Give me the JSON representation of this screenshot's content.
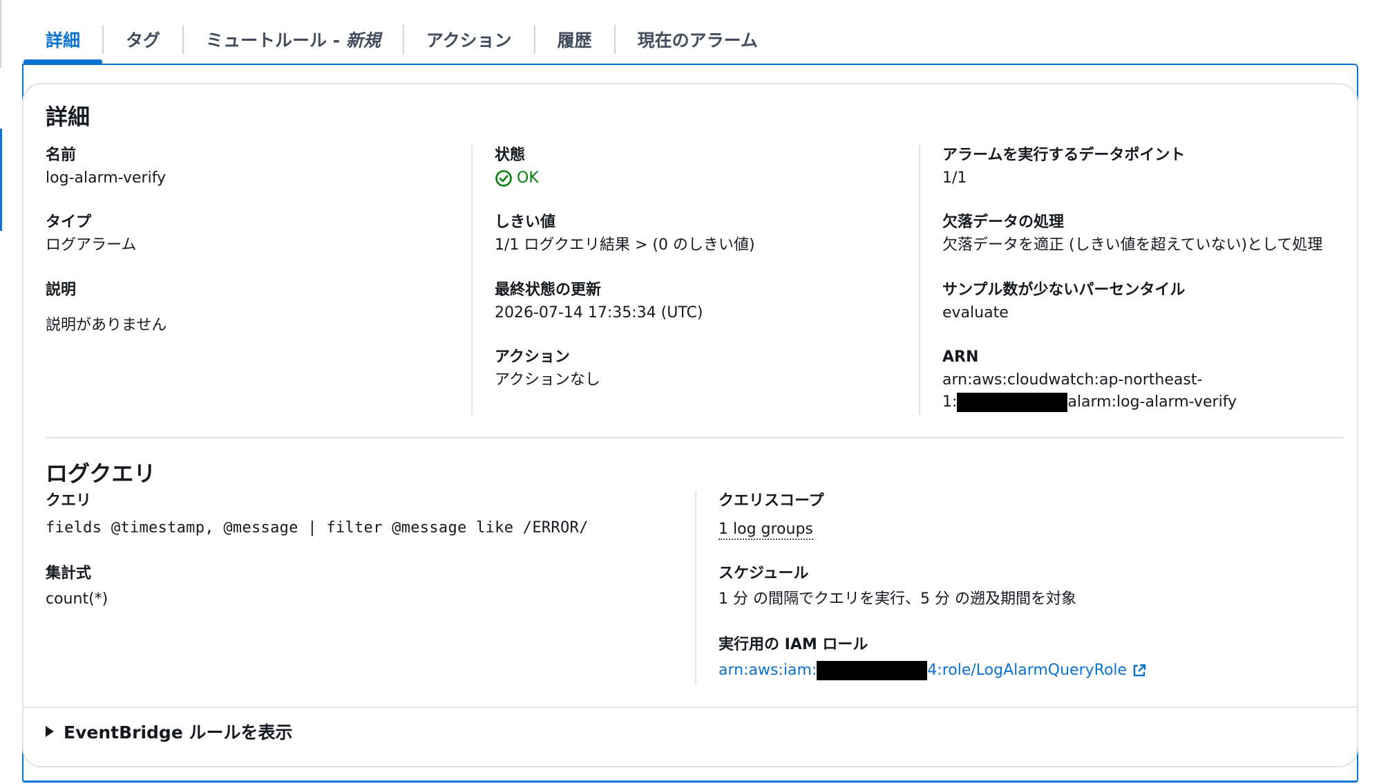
{
  "tabs": [
    {
      "label": "詳細",
      "active": true
    },
    {
      "label": "タグ",
      "active": false
    },
    {
      "label": "ミュートルール - ",
      "italic": "新規",
      "active": false
    },
    {
      "label": "アクション",
      "active": false
    },
    {
      "label": "履歴",
      "active": false
    },
    {
      "label": "現在のアラーム",
      "active": false
    }
  ],
  "details": {
    "title": "詳細",
    "name_label": "名前",
    "name_value": "log-alarm-verify",
    "type_label": "タイプ",
    "type_value": "ログアラーム",
    "desc_label": "説明",
    "desc_value": "説明がありません",
    "state_label": "状態",
    "state_value": "OK",
    "threshold_label": "しきい値",
    "threshold_value": "1/1 ログクエリ結果 > (0 のしきい値)",
    "last_update_label": "最終状態の更新",
    "last_update_value": "2026-07-14 17:35:34 (UTC)",
    "actions_label": "アクション",
    "actions_value": "アクションなし",
    "datapoints_label": "アラームを実行するデータポイント",
    "datapoints_value": "1/1",
    "missing_label": "欠落データの処理",
    "missing_value": "欠落データを適正 (しきい値を超えていない)として処理",
    "percentile_label": "サンプル数が少ないパーセンタイル",
    "percentile_value": "evaluate",
    "arn_label": "ARN",
    "arn_line1": "arn:aws:cloudwatch:ap-northeast-",
    "arn_line2_prefix": "1:",
    "arn_line2_suffix": "alarm:log-alarm-verify"
  },
  "log_query": {
    "title": "ログクエリ",
    "query_label": "クエリ",
    "query_value": "fields @timestamp, @message | filter @message like /ERROR/",
    "agg_label": "集計式",
    "agg_value": "count(*)",
    "scope_label": "クエリスコープ",
    "scope_value": "1 log groups",
    "schedule_label": "スケジュール",
    "schedule_value": "1 分 の間隔でクエリを実行、5 分 の遡及期間を対象",
    "iam_label": "実行用の IAM ロール",
    "iam_prefix": "arn:aws:iam:",
    "iam_suffix": "4:role/LogAlarmQueryRole"
  },
  "eventbridge": {
    "label": "EventBridge ルールを表示"
  },
  "colors": {
    "accent": "#0972d3",
    "ok": "#037f0c"
  }
}
